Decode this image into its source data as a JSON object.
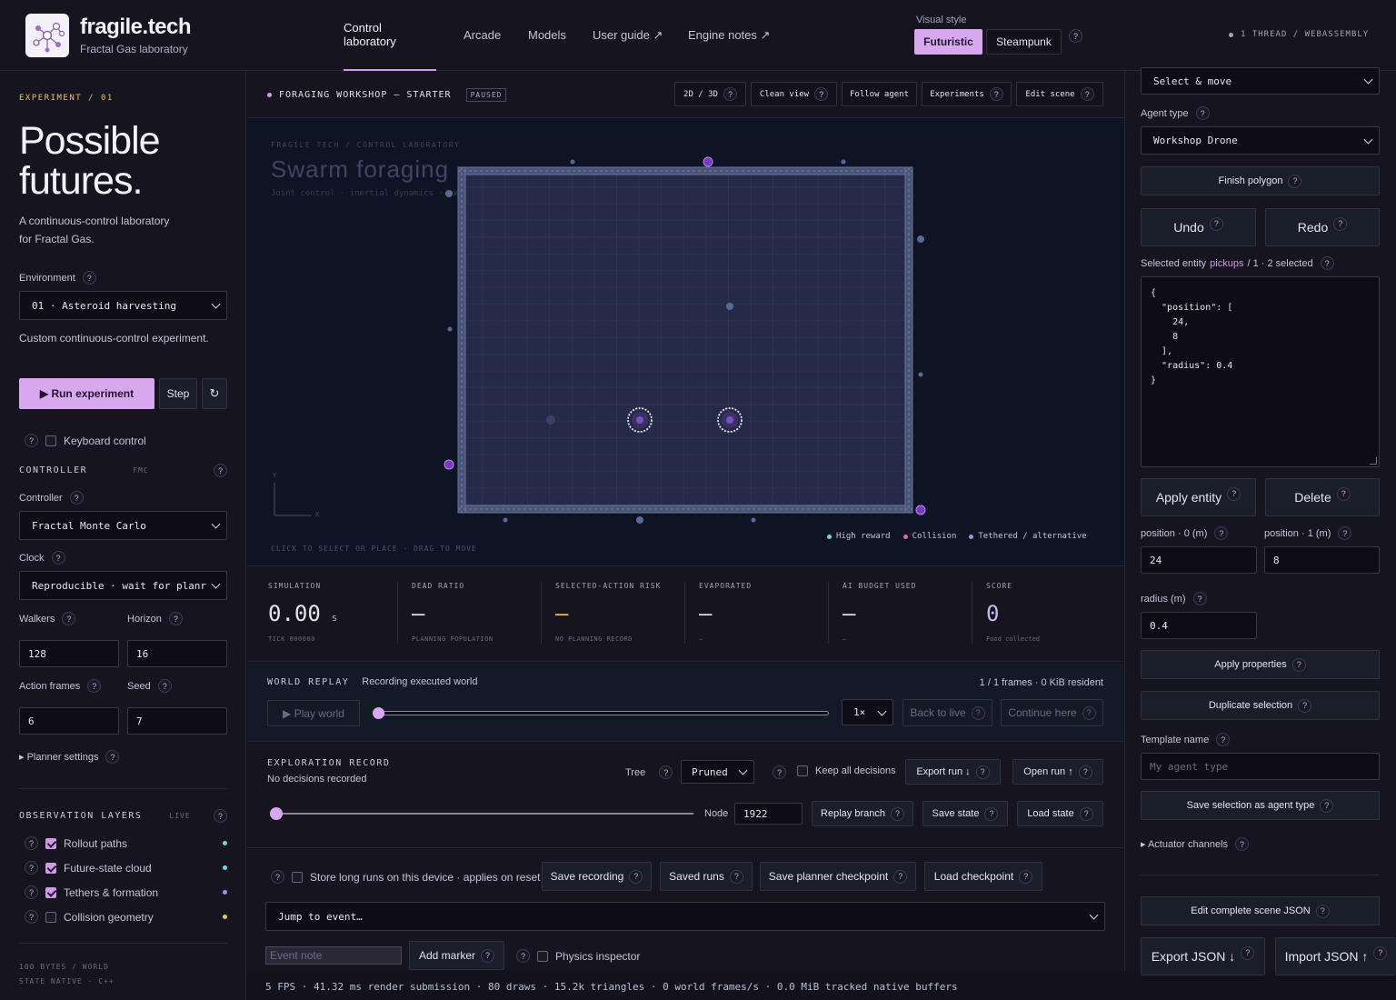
{
  "header": {
    "brand_title": "fragile.tech",
    "brand_subtitle": "Fractal Gas laboratory",
    "nav": [
      {
        "label": "Control laboratory"
      },
      {
        "label": "Arcade"
      },
      {
        "label": "Models"
      },
      {
        "label": "User guide ↗"
      },
      {
        "label": "Engine notes ↗"
      }
    ],
    "visual_style_label": "Visual style",
    "style_futuristic": "Futuristic",
    "style_steampunk": "Steampunk",
    "thread_info": "1 THREAD / WEBASSEMBLY"
  },
  "left": {
    "experiment_tag": "EXPERIMENT / 01",
    "hero_line1": "Possible",
    "hero_line2": "futures.",
    "desc_line1": "A continuous-control laboratory",
    "desc_line2": "for Fractal Gas.",
    "environment_label": "Environment",
    "environment_value": "01 · Asteroid harvesting",
    "environment_note": "Custom continuous-control experiment.",
    "run_label": "▶ Run experiment",
    "step_label": "Step",
    "reset_icon": "↻",
    "keyboard_label": "Keyboard control",
    "controller_section": "CONTROLLER",
    "controller_tag": "FMC",
    "controller_label": "Controller",
    "controller_value": "Fractal Monte Carlo",
    "clock_label": "Clock",
    "clock_value": "Reproducible · wait for planr",
    "walkers_label": "Walkers",
    "walkers_value": "128",
    "horizon_label": "Horizon",
    "horizon_value": "16",
    "action_frames_label": "Action frames",
    "action_frames_value": "6",
    "seed_label": "Seed",
    "seed_value": "7",
    "planner_settings": "▸ Planner settings",
    "obs_section": "OBSERVATION LAYERS",
    "obs_tag": "LIVE",
    "layers": [
      {
        "label": "Rollout paths",
        "color": "#6fe0b8",
        "checked": true
      },
      {
        "label": "Future-state cloud",
        "color": "#6fd8e8",
        "checked": true
      },
      {
        "label": "Tethers & formation",
        "color": "#a58cf0",
        "checked": true
      },
      {
        "label": "Collision geometry",
        "color": "#f0c060",
        "checked": false
      }
    ],
    "footer_line1": "100 BYTES / WORLD",
    "footer_line2": "STATE NATIVE · C++"
  },
  "center": {
    "scene_title": "FORAGING WORKSHOP — STARTER",
    "paused_badge": "PAUSED",
    "toolbar": [
      "2D / 3D",
      "Clean view",
      "Follow agent",
      "Experiments",
      "Edit scene"
    ],
    "canvas_caption": "FRAGILE TECH / CONTROL LABORATORY",
    "canvas_title": "Swarm foraging",
    "canvas_subtitle": "Joint control · inertial dynamics · exact state replay",
    "axis_y": "Y",
    "axis_x": "X",
    "canvas_hint": "CLICK TO SELECT OR PLACE · DRAG TO MOVE",
    "legend": [
      {
        "label": "High reward",
        "color": "#6fe0b8"
      },
      {
        "label": "Collision",
        "color": "#f06a8a"
      },
      {
        "label": "Tethered / alternative",
        "color": "#a58cf0"
      }
    ],
    "stats": [
      {
        "label": "SIMULATION",
        "value": "0.00",
        "unit": "s",
        "sub": "TICK 000000",
        "color": "#e8e4f2"
      },
      {
        "label": "DEAD RATIO",
        "value": "—",
        "unit": "",
        "sub": "PLANNING POPULATION",
        "color": "#e8e4f2"
      },
      {
        "label": "SELECTED-ACTION RISK",
        "value": "—",
        "unit": "",
        "sub": "NO PLANNING RECORD",
        "color": "#f0c060"
      },
      {
        "label": "EVAPORATED",
        "value": "—",
        "unit": "",
        "sub": "—",
        "color": "#e8e4f2"
      },
      {
        "label": "AI BUDGET USED",
        "value": "—",
        "unit": "",
        "sub": "—",
        "color": "#e8e4f2"
      },
      {
        "label": "SCORE",
        "value": "0",
        "unit": "",
        "sub": "Food collected",
        "color": "#c9b8ef"
      }
    ],
    "replay_title": "WORLD REPLAY",
    "replay_status": "Recording executed world",
    "replay_frames": "1 / 1 frames · 0 KiB resident",
    "play_world": "▶ Play world",
    "speed_value": "1×",
    "back_to_live": "Back to live",
    "continue_here": "Continue here",
    "exploration_title": "EXPLORATION RECORD",
    "exploration_status": "No decisions recorded",
    "tree_label": "Tree",
    "tree_value": "Pruned",
    "keep_all": "Keep all decisions",
    "export_run": "Export run ↓",
    "open_run": "Open run ↑",
    "node_label": "Node",
    "node_value": "1922",
    "replay_branch": "Replay branch",
    "save_state": "Save state",
    "load_state": "Load state",
    "store_long": "Store long runs on this device · applies on reset",
    "save_recording": "Save recording",
    "saved_runs": "Saved runs",
    "save_checkpoint": "Save planner checkpoint",
    "load_checkpoint": "Load checkpoint",
    "jump_value": "Jump to event…",
    "event_note_placeholder": "Event note",
    "add_marker": "Add marker",
    "physics_inspector": "Physics inspector",
    "status_bar": "5 FPS · 41.32 ms render submission · 80 draws · 15.2k triangles · 0 world frames/s · 0.0 MiB tracked native buffers"
  },
  "right": {
    "tool_value": "Select & move",
    "agent_type_label": "Agent type",
    "agent_type_value": "Workshop Drone",
    "finish_polygon": "Finish polygon",
    "undo": "Undo",
    "redo": "Redo",
    "selected_prefix": "Selected entity",
    "selected_link": "pickups",
    "selected_suffix": "/ 1 · 2 selected",
    "entity_json": "{\n  \"position\": [\n    24,\n    8\n  ],\n  \"radius\": 0.4\n}",
    "apply_entity": "Apply entity",
    "delete": "Delete",
    "pos0_label": "position · 0 (m)",
    "pos1_label": "position · 1 (m)",
    "pos0_value": "24",
    "pos1_value": "8",
    "radius_label": "radius (m)",
    "radius_value": "0.4",
    "apply_properties": "Apply properties",
    "duplicate_selection": "Duplicate selection",
    "template_label": "Template name",
    "template_placeholder": "My agent type",
    "save_agent_type": "Save selection as agent type",
    "actuator_channels": "▸ Actuator channels",
    "edit_scene_json": "Edit complete scene JSON",
    "export_json": "Export JSON ↓",
    "import_json": "Import JSON ↑"
  }
}
